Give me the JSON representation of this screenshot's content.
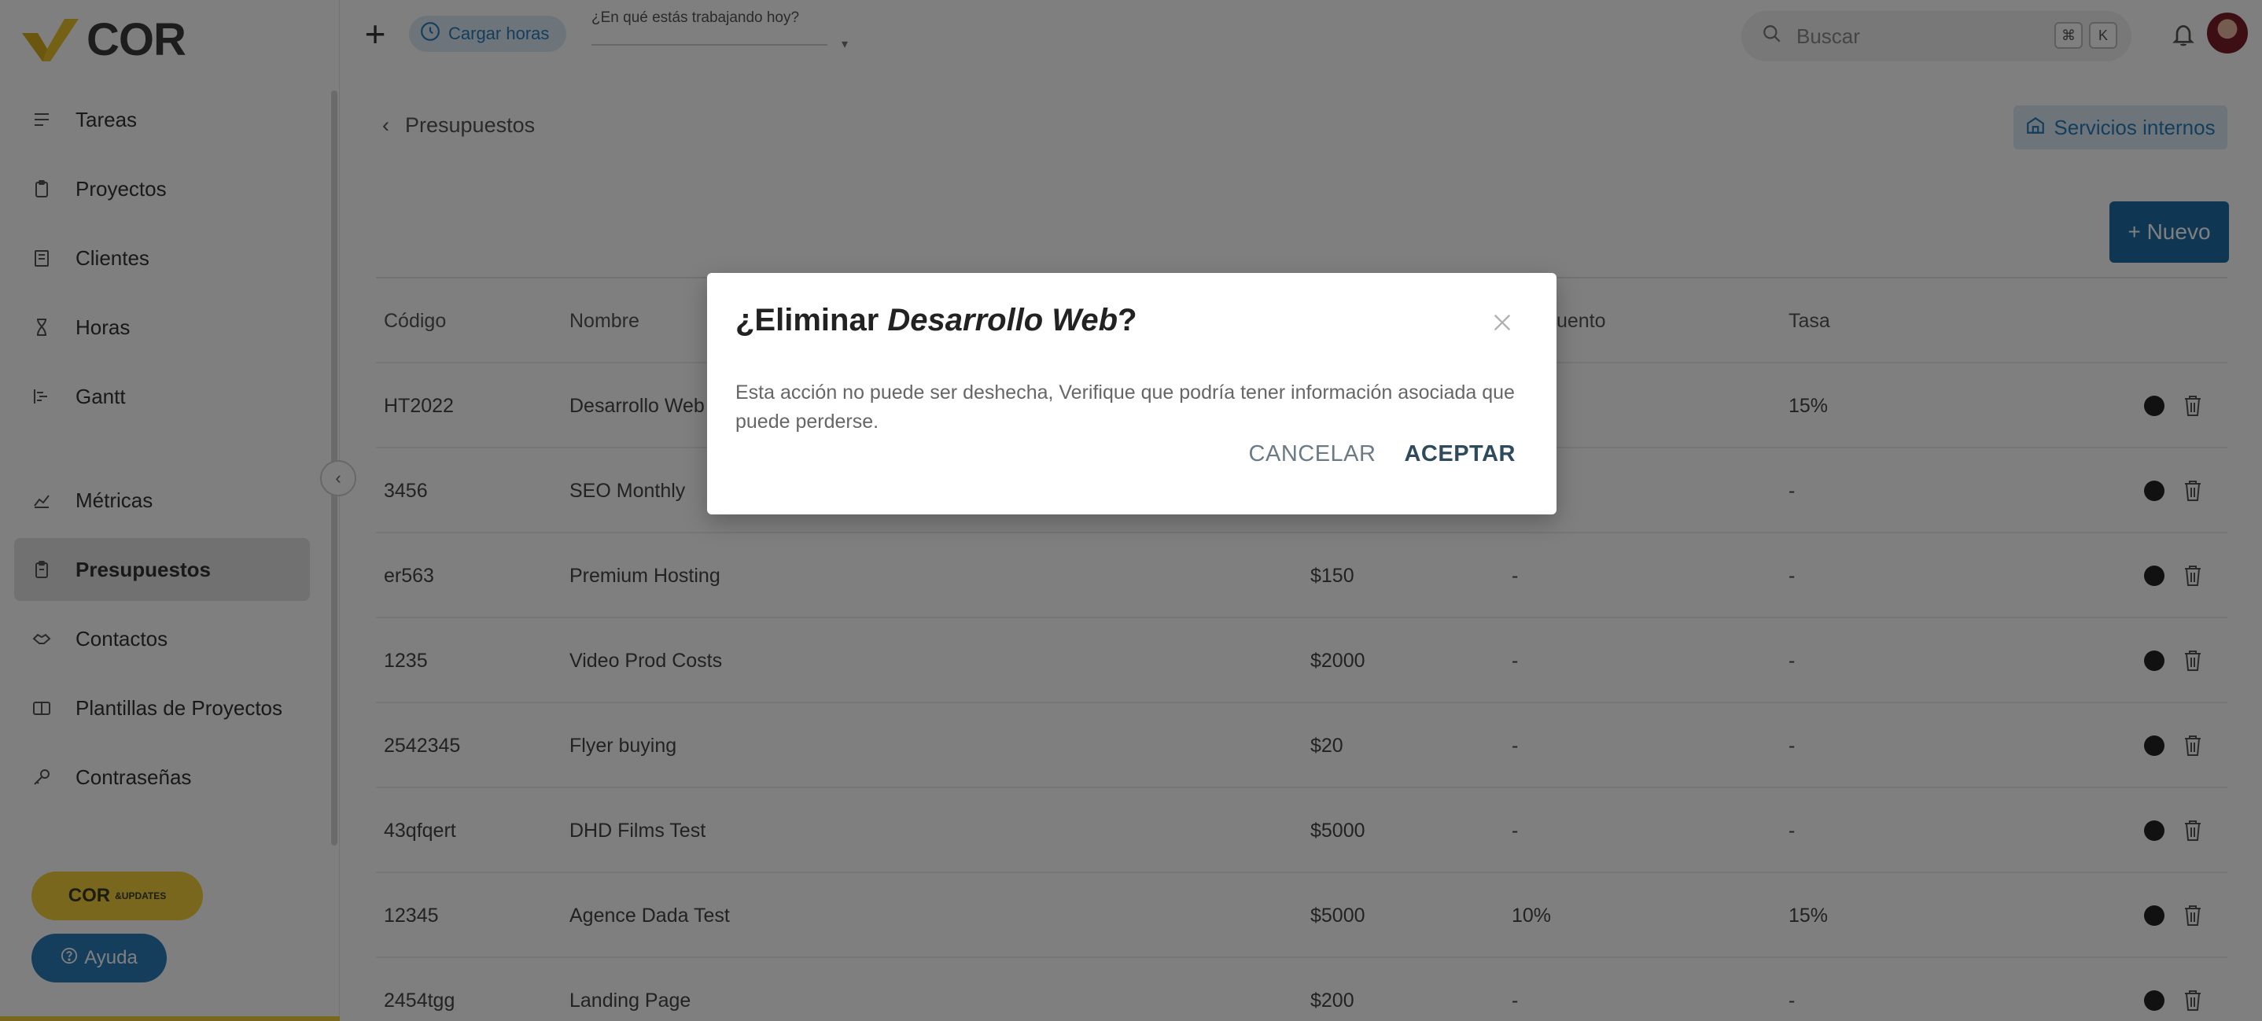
{
  "app": {
    "logo_text": "COR"
  },
  "sidebar": {
    "items": [
      {
        "label": "Tareas",
        "icon": "tasks-icon"
      },
      {
        "label": "Proyectos",
        "icon": "clipboard-icon"
      },
      {
        "label": "Clientes",
        "icon": "building-icon"
      },
      {
        "label": "Horas",
        "icon": "hourglass-icon"
      },
      {
        "label": "Gantt",
        "icon": "gantt-icon"
      },
      {
        "label": "Métricas",
        "icon": "chart-icon"
      },
      {
        "label": "Presupuestos",
        "icon": "budget-icon",
        "active": true
      },
      {
        "label": "Contactos",
        "icon": "handshake-icon"
      },
      {
        "label": "Plantillas de Proyectos",
        "icon": "template-icon"
      },
      {
        "label": "Contraseñas",
        "icon": "key-icon"
      }
    ],
    "updates_label": "COR",
    "updates_badge": "&UPDATES",
    "help_label": "Ayuda"
  },
  "topbar": {
    "cargar_label": "Cargar horas",
    "working_prompt": "¿En qué estás trabajando hoy?",
    "search_placeholder": "Buscar",
    "kbd_1": "⌘",
    "kbd_2": "K"
  },
  "main": {
    "breadcrumb": "Presupuestos",
    "services_label": "Servicios internos",
    "new_label": "+ Nuevo",
    "columns": {
      "code": "Código",
      "name": "Nombre",
      "discount": "Descuento",
      "tax": "Tasa"
    },
    "rows": [
      {
        "code": "HT2022",
        "name": "Desarrollo Web",
        "budget": "",
        "discount": "",
        "tax": "15%"
      },
      {
        "code": "3456",
        "name": "SEO Monthly",
        "budget": "",
        "discount": "",
        "tax": "-"
      },
      {
        "code": "er563",
        "name": "Premium Hosting",
        "budget": "$150",
        "discount": "-",
        "tax": "-"
      },
      {
        "code": "1235",
        "name": "Video Prod Costs",
        "budget": "$2000",
        "discount": "-",
        "tax": "-"
      },
      {
        "code": "2542345",
        "name": "Flyer buying",
        "budget": "$20",
        "discount": "-",
        "tax": "-"
      },
      {
        "code": "43qfqert",
        "name": "DHD Films Test",
        "budget": "$5000",
        "discount": "-",
        "tax": "-"
      },
      {
        "code": "12345",
        "name": "Agence Dada Test",
        "budget": "$5000",
        "discount": "10%",
        "tax": "15%"
      },
      {
        "code": "2454tgg",
        "name": "Landing Page",
        "budget": "$200",
        "discount": "-",
        "tax": "-"
      }
    ]
  },
  "dialog": {
    "title_prefix": "¿Eliminar ",
    "title_item": "Desarrollo Web",
    "title_suffix": "?",
    "body": "Esta acción no puede ser deshecha, Verifique que podría tener información asociada que puede perderse.",
    "cancel_label": "CANCELAR",
    "accept_label": "ACEPTAR"
  },
  "colors": {
    "brand_yellow": "#f1cf3a",
    "primary_blue": "#1f6fa8",
    "accept_text": "#2e4a5c",
    "overlay": "rgba(0,0,0,0.5)"
  }
}
